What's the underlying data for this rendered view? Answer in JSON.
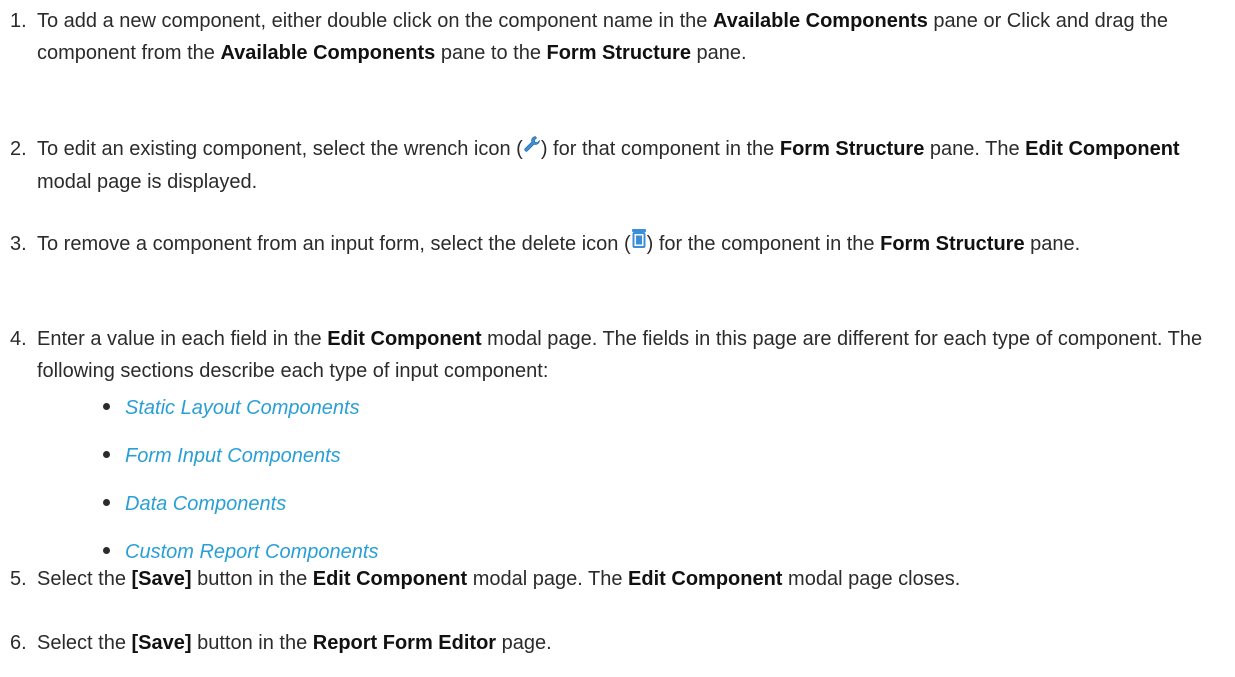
{
  "steps": [
    {
      "number": "1.",
      "parts": [
        {
          "t": "To add a new component, either double click on the component name in the "
        },
        {
          "t": "Available Components",
          "b": true
        },
        {
          "t": " pane or Click and drag the component from the "
        },
        {
          "t": "Available Components",
          "b": true
        },
        {
          "t": " pane to the "
        },
        {
          "t": "Form Structure",
          "b": true
        },
        {
          "t": " pane."
        }
      ]
    },
    {
      "number": "2.",
      "parts": [
        {
          "t": "To edit an existing component, select the wrench icon ("
        },
        {
          "icon": "wrench-icon"
        },
        {
          "t": ") for that component in the "
        },
        {
          "t": "Form Structure",
          "b": true
        },
        {
          "t": " pane. The "
        },
        {
          "t": "Edit Component",
          "b": true
        },
        {
          "t": " modal page is displayed."
        }
      ]
    },
    {
      "number": "3.",
      "parts": [
        {
          "t": "To remove a component from an input form, select the delete icon ("
        },
        {
          "icon": "delete-icon"
        },
        {
          "t": ") for the component in the "
        },
        {
          "t": "Form Structure",
          "b": true
        },
        {
          "t": " pane."
        }
      ]
    },
    {
      "number": "4.",
      "parts": [
        {
          "t": "Enter a value in each field in the "
        },
        {
          "t": "Edit Component",
          "b": true
        },
        {
          "t": " modal page. The fields in this page are different for each type of component. The following sections describe each type of input component:"
        }
      ]
    },
    {
      "number": "5.",
      "parts": [
        {
          "t": "Select the "
        },
        {
          "t": "[Save]",
          "b": true
        },
        {
          "t": " button in the "
        },
        {
          "t": "Edit Component",
          "b": true
        },
        {
          "t": " modal page. The "
        },
        {
          "t": "Edit Component",
          "b": true
        },
        {
          "t": " modal page closes."
        }
      ]
    },
    {
      "number": "6.",
      "parts": [
        {
          "t": "Select the "
        },
        {
          "t": "[Save]",
          "b": true
        },
        {
          "t": " button in the "
        },
        {
          "t": "Report Form Editor",
          "b": true
        },
        {
          "t": " page."
        }
      ]
    }
  ],
  "component_links": [
    "Static Layout Components",
    "Form Input Components",
    "Data Components",
    "Custom Report Components"
  ],
  "colors": {
    "text": "#2b2b2b",
    "link": "#2a9fd6",
    "icon_blue": "#3a8fd8"
  }
}
